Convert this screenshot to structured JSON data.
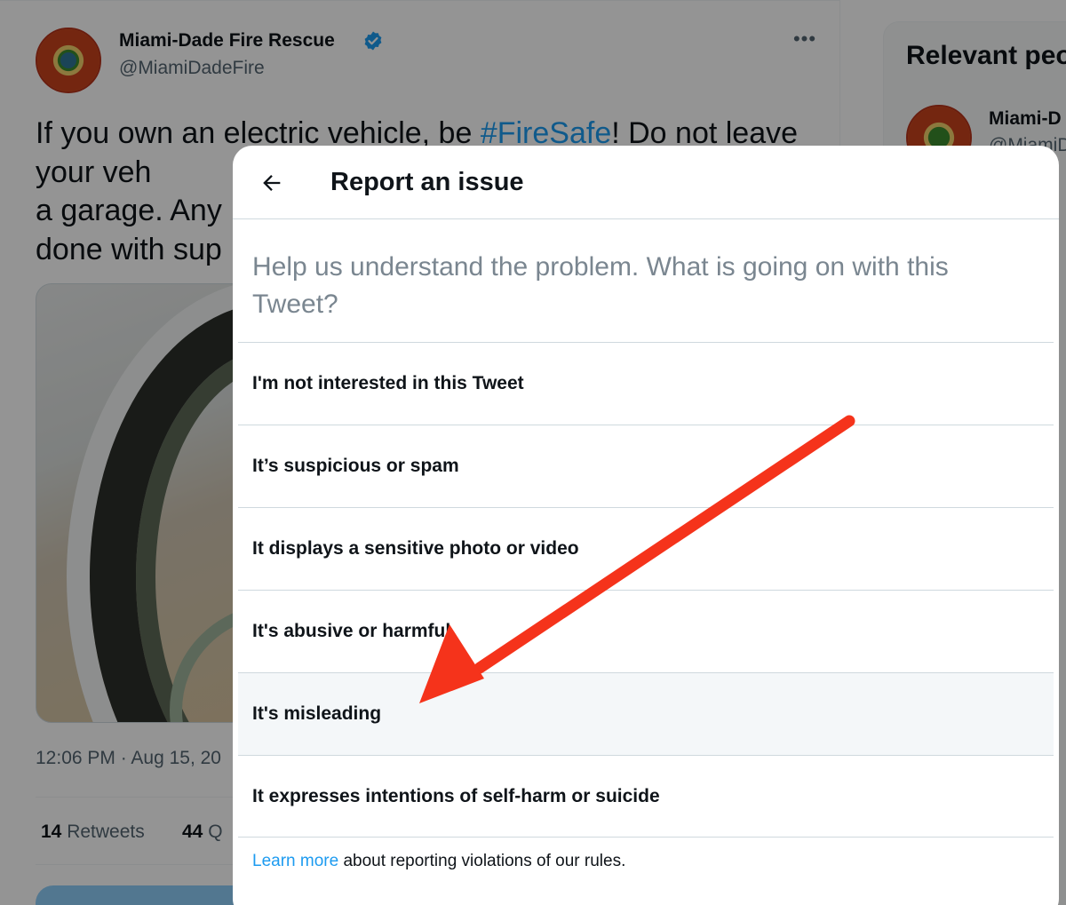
{
  "tweet": {
    "author_name": "Miami-Dade Fire Rescue",
    "handle": "@MiamiDadeFire",
    "more_label": "•••",
    "text_before": "If you own an electric vehicle, be ",
    "hashtag": "#FireSafe",
    "text_after": "! Do not leave your veh",
    "line2": "a garage. Any",
    "line3": "done with sup",
    "timestamp": "12:06 PM · Aug 15, 20",
    "retweets_count": "14",
    "retweets_label": "Retweets",
    "quotes_count": "44",
    "quotes_label": "Q"
  },
  "sidebar": {
    "title": "Relevant peo",
    "person_name": "Miami-D",
    "person_handle": "@MiamiD"
  },
  "modal": {
    "title": "Report an issue",
    "question": "Help us understand the problem. What is going on with this Tweet?",
    "options": [
      {
        "label": "I'm not interested in this Tweet"
      },
      {
        "label": "It’s suspicious or spam"
      },
      {
        "label": "It displays a sensitive photo or video"
      },
      {
        "label": "It's abusive or harmful"
      },
      {
        "label": "It's misleading"
      },
      {
        "label": "It expresses intentions of self-harm or suicide"
      }
    ],
    "hovered_option_index": 4,
    "learn_more_link": "Learn more",
    "learn_more_rest": " about reporting violations of our rules."
  },
  "annotation": {
    "arrow_color": "#f5331b",
    "points_to": "It's misleading"
  },
  "colors": {
    "accent": "#1d9bf0",
    "overlay": "rgba(0,0,0,0.42)"
  }
}
